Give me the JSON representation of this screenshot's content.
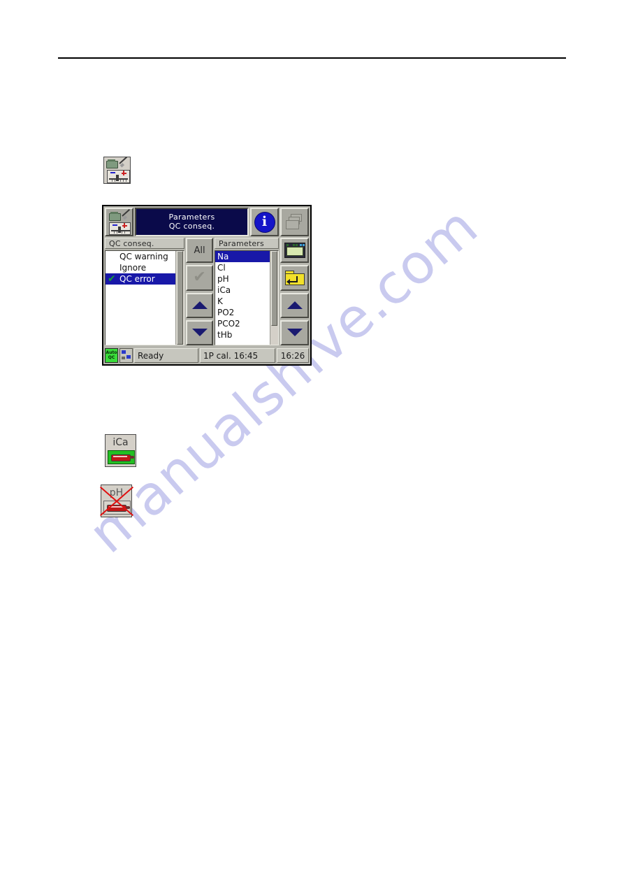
{
  "page": {
    "watermark": "manualshive.com"
  },
  "doc_icons": [
    {
      "name": "calibration-icon",
      "label": ""
    },
    {
      "name": "ica-electrode-icon",
      "label": "iCa"
    },
    {
      "name": "ph-electrode-disabled-icon",
      "label": "pH"
    }
  ],
  "analyzer": {
    "header": {
      "menu_icon": "calibration-icon",
      "title_line1": "Parameters",
      "title_line2": "QC conseq.",
      "info_icon": "info-icon",
      "info_label": "i",
      "print_icon": "print-pages-icon"
    },
    "left_list": {
      "title": "QC conseq.",
      "items": [
        {
          "label": "QC warning",
          "selected": false,
          "checked": false
        },
        {
          "label": "Ignore",
          "selected": false,
          "checked": false
        },
        {
          "label": "QC error",
          "selected": true,
          "checked": true
        }
      ],
      "check_glyph": "✔"
    },
    "middle_buttons": [
      {
        "name": "all-button",
        "label": "All",
        "type": "text",
        "disabled": false
      },
      {
        "name": "confirm-button",
        "label": "✔",
        "type": "check",
        "disabled": true
      },
      {
        "name": "scroll-up-button",
        "label": "",
        "type": "up",
        "disabled": false
      },
      {
        "name": "scroll-down-button",
        "label": "",
        "type": "down",
        "disabled": false
      }
    ],
    "right_list": {
      "title": "Parameters",
      "items": [
        {
          "label": "Na",
          "selected": true
        },
        {
          "label": "Cl",
          "selected": false
        },
        {
          "label": "pH",
          "selected": false
        },
        {
          "label": "iCa",
          "selected": false
        },
        {
          "label": "K",
          "selected": false
        },
        {
          "label": "PO2",
          "selected": false
        },
        {
          "label": "PCO2",
          "selected": false
        },
        {
          "label": "tHb",
          "selected": false
        }
      ]
    },
    "far_buttons": [
      {
        "name": "keypad-button",
        "icon": "keypad-icon"
      },
      {
        "name": "back-folder-button",
        "icon": "folder-back-icon"
      },
      {
        "name": "list-scroll-up-button",
        "icon": "triangle-up-icon"
      },
      {
        "name": "list-scroll-down-button",
        "icon": "triangle-down-icon"
      }
    ],
    "status_bar": {
      "qc_badge_line1": "Auto",
      "qc_badge_line2": "QC",
      "network_icon": "network-icon",
      "status_text": "Ready",
      "calibration_text": "1P cal. 16:45",
      "clock": "16:26"
    },
    "colors": {
      "title_bar": "#0a0a4a",
      "selection": "#1818a8",
      "chrome": "#b6b6ae",
      "button_face": "#a8a8a0",
      "check_green": "#179b37",
      "qc_badge_green": "#3adc3a",
      "folder_yellow": "#f2e02a",
      "info_blue": "#1414c8",
      "disabled_cross_red": "#e01010"
    }
  }
}
